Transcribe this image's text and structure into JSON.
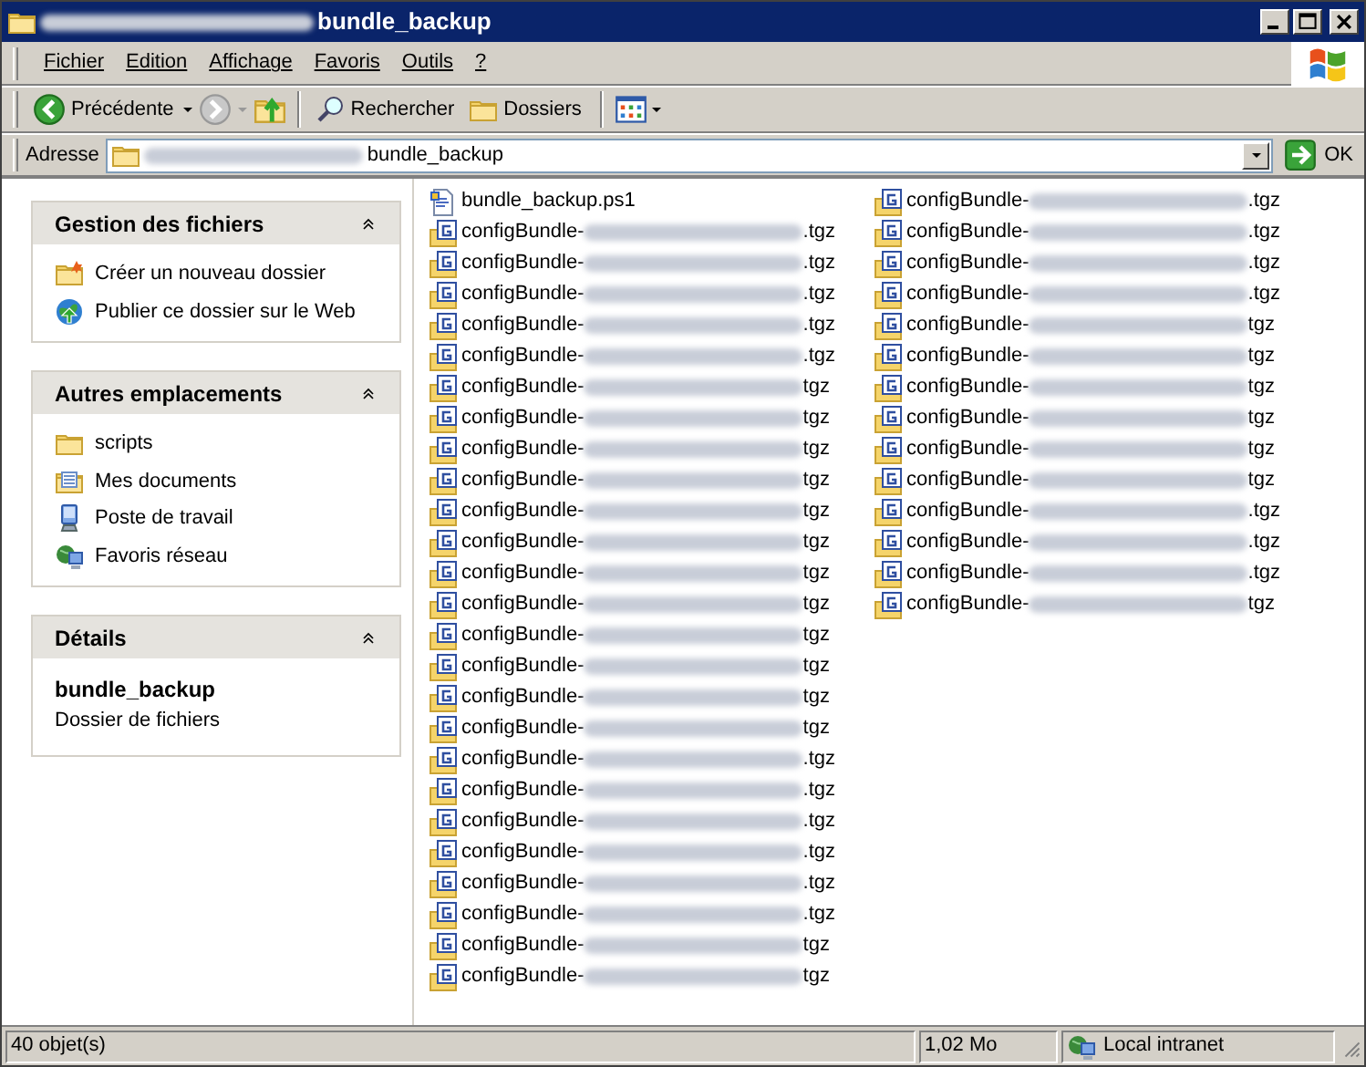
{
  "window": {
    "title": "bundle_backup",
    "title_redacted": true
  },
  "menu": [
    "Fichier",
    "Edition",
    "Affichage",
    "Favoris",
    "Outils",
    "?"
  ],
  "toolbar": {
    "back": "Précédente",
    "search": "Rechercher",
    "folders": "Dossiers"
  },
  "address": {
    "label": "Adresse",
    "value": "bundle_backup",
    "value_redacted": true,
    "go": "OK"
  },
  "sidebar": [
    {
      "title": "Gestion des fichiers",
      "expanded": true,
      "items": [
        {
          "kind": "new-folder",
          "label": "Créer un nouveau dossier"
        },
        {
          "kind": "web",
          "label": "Publier ce dossier sur le Web"
        }
      ]
    },
    {
      "title": "Autres emplacements",
      "expanded": true,
      "items": [
        {
          "kind": "folder",
          "label": "scripts"
        },
        {
          "kind": "documents",
          "label": "Mes documents"
        },
        {
          "kind": "computer",
          "label": "Poste de travail"
        },
        {
          "kind": "network",
          "label": "Favoris réseau"
        }
      ]
    },
    {
      "title": "Détails",
      "expanded": true,
      "details": {
        "name": "bundle_backup",
        "type": "Dossier de fichiers"
      }
    }
  ],
  "files": [
    {
      "kind": "script",
      "name": "bundle_backup.ps1"
    },
    {
      "kind": "archive",
      "name": "configBundle-",
      "suffix": ".tgz",
      "redacted": true
    },
    {
      "kind": "archive",
      "name": "configBundle-",
      "suffix": ".tgz",
      "redacted": true
    },
    {
      "kind": "archive",
      "name": "configBundle-",
      "suffix": ".tgz",
      "redacted": true
    },
    {
      "kind": "archive",
      "name": "configBundle-",
      "suffix": ".tgz",
      "redacted": true
    },
    {
      "kind": "archive",
      "name": "configBundle-",
      "suffix": ".tgz",
      "redacted": true
    },
    {
      "kind": "archive",
      "name": "configBundle-",
      "suffix": "tgz",
      "redacted": true
    },
    {
      "kind": "archive",
      "name": "configBundle-",
      "suffix": "tgz",
      "redacted": true
    },
    {
      "kind": "archive",
      "name": "configBundle-",
      "suffix": "tgz",
      "redacted": true
    },
    {
      "kind": "archive",
      "name": "configBundle-",
      "suffix": "tgz",
      "redacted": true
    },
    {
      "kind": "archive",
      "name": "configBundle-",
      "suffix": "tgz",
      "redacted": true
    },
    {
      "kind": "archive",
      "name": "configBundle-",
      "suffix": "tgz",
      "redacted": true
    },
    {
      "kind": "archive",
      "name": "configBundle-",
      "suffix": "tgz",
      "redacted": true
    },
    {
      "kind": "archive",
      "name": "configBundle-",
      "suffix": "tgz",
      "redacted": true
    },
    {
      "kind": "archive",
      "name": "configBundle-",
      "suffix": "tgz",
      "redacted": true
    },
    {
      "kind": "archive",
      "name": "configBundle-",
      "suffix": "tgz",
      "redacted": true
    },
    {
      "kind": "archive",
      "name": "configBundle-",
      "suffix": "tgz",
      "redacted": true
    },
    {
      "kind": "archive",
      "name": "configBundle-",
      "suffix": "tgz",
      "redacted": true
    },
    {
      "kind": "archive",
      "name": "configBundle-",
      "suffix": ".tgz",
      "redacted": true
    },
    {
      "kind": "archive",
      "name": "configBundle-",
      "suffix": ".tgz",
      "redacted": true
    },
    {
      "kind": "archive",
      "name": "configBundle-",
      "suffix": ".tgz",
      "redacted": true
    },
    {
      "kind": "archive",
      "name": "configBundle-",
      "suffix": ".tgz",
      "redacted": true
    },
    {
      "kind": "archive",
      "name": "configBundle-",
      "suffix": ".tgz",
      "redacted": true
    },
    {
      "kind": "archive",
      "name": "configBundle-",
      "suffix": ".tgz",
      "redacted": true
    },
    {
      "kind": "archive",
      "name": "configBundle-",
      "suffix": "tgz",
      "redacted": true
    },
    {
      "kind": "archive",
      "name": "configBundle-",
      "suffix": "tgz",
      "redacted": true
    },
    {
      "kind": "archive",
      "name": "configBundle-",
      "suffix": ".tgz",
      "redacted": true
    },
    {
      "kind": "archive",
      "name": "configBundle-",
      "suffix": ".tgz",
      "redacted": true
    },
    {
      "kind": "archive",
      "name": "configBundle-",
      "suffix": ".tgz",
      "redacted": true
    },
    {
      "kind": "archive",
      "name": "configBundle-",
      "suffix": ".tgz",
      "redacted": true
    },
    {
      "kind": "archive",
      "name": "configBundle-",
      "suffix": "tgz",
      "redacted": true
    },
    {
      "kind": "archive",
      "name": "configBundle-",
      "suffix": "tgz",
      "redacted": true
    },
    {
      "kind": "archive",
      "name": "configBundle-",
      "suffix": "tgz",
      "redacted": true
    },
    {
      "kind": "archive",
      "name": "configBundle-",
      "suffix": "tgz",
      "redacted": true
    },
    {
      "kind": "archive",
      "name": "configBundle-",
      "suffix": "tgz",
      "redacted": true
    },
    {
      "kind": "archive",
      "name": "configBundle-",
      "suffix": "tgz",
      "redacted": true
    },
    {
      "kind": "archive",
      "name": "configBundle-",
      "suffix": ".tgz",
      "redacted": true
    },
    {
      "kind": "archive",
      "name": "configBundle-",
      "suffix": ".tgz",
      "redacted": true
    },
    {
      "kind": "archive",
      "name": "configBundle-",
      "suffix": ".tgz",
      "redacted": true
    },
    {
      "kind": "archive",
      "name": "configBundle-",
      "suffix": "tgz",
      "redacted": true
    }
  ],
  "status_bar": {
    "count": "40 objet(s)",
    "size": "1,02 Mo",
    "zone": "Local intranet"
  }
}
